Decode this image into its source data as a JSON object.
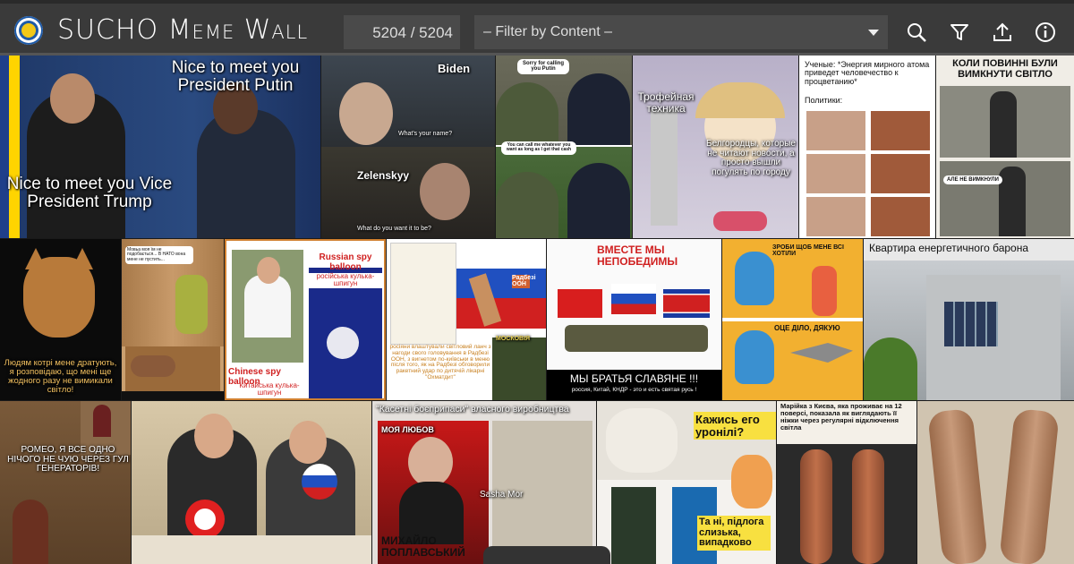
{
  "app": {
    "title_s": "SUCHO",
    "title_rest": "Meme Wall",
    "counter": "5204 / 5204",
    "filter_placeholder": "– Filter by Content –"
  },
  "toolbar_icons": [
    "search-icon",
    "filter-icon",
    "upload-icon",
    "info-icon"
  ],
  "memes": {
    "m1_top": "Nice to meet you President Putin",
    "m1_bottom": "Nice to meet you Vice President Trump",
    "m2_a": "Biden",
    "m2_b": "Zelenskyy",
    "m2_c": "What's your name?",
    "m2_d": "What do you want it to be?",
    "m3_a": "Sorry for calling you Putin",
    "m3_b": "You can call me whatever you want as long as I get that cash",
    "m4_a": "Трофейная техника",
    "m4_b": "Белгородцы, которые не читают новости, а просто вышли погулять по городу",
    "m5_a": "Ученые: *Энергия мирного атома приведет человечество к процветанию*",
    "m5_b": "Политики:",
    "m6_a": "КОЛИ ПОВИННІ БУЛИ ВИМКНУТИ СВІТЛО",
    "m6_b": "АЛЕ НЕ ВИМКНУЛИ",
    "m7_a": "Людям котрі мене дратують, я розповідаю, що мені ще жодного разу не вимикали світло!",
    "m8_a": "Мовьа моя їм не подобається... В НАТО вона мене не пустить...",
    "m9_a": "Russian spy balloon",
    "m9_b": "російська кулька-шпигун",
    "m9_c": "Chinese spy balloon",
    "m9_d": "Китайська кулька-шпигун",
    "m10_a": "Радбезі ООН",
    "m10_b": "росіяни влаштували світловий ланч з нагоди свого головування в Радбезі ООН, з вигнетом по-київськи в меню після того, як на Радбезі обговорили ракетний удар по дитячій лікарні \"Охматдит\"",
    "m10_c": "МОСКОВІЯ",
    "m11_a": "ВМЕСТЕ МЫ НЕПОБЕДИМЫ",
    "m11_b": "МЫ БРАТЬЯ СЛАВЯНЕ !!!",
    "m11_c": "россия, Китай, КНДР - это и есть святая русь !",
    "m12_a": "ЗРОБИ ЩОБ МЕНЕ ВСІ ХОТІЛИ",
    "m12_b": "ОЦЕ ДІЛО, ДЯКУЮ",
    "m13_a": "Квартира енергетичного барона",
    "m14_a": "РОМЕО, Я ВСЕ ОДНО НІЧОГО НЕ ЧУЮ ЧЕРЕЗ ГУЛ ГЕНЕРАТОРІВ!",
    "m16_a": "\"Касетні боєприпаси\" власного виробництва",
    "m16_b": "МОЯ ЛЮБОВ",
    "m16_c": "Sasha Mor",
    "m16_d": "МИХАЙЛО ПОПЛАВСЬКИЙ",
    "m17_a": "Кажись его уронілі?",
    "m17_b": "Та ні, підлога слизька, випадково",
    "m18_a": "Марійка з Києва, яка проживає на 12 поверсі, показала як виглядають її ніжки через регулярні відключення світла"
  },
  "colors": {
    "topbar": "#3a3a3a",
    "input_bg": "#4a4a4a",
    "text": "#ffffff",
    "accent_yellow": "#f2c818",
    "accent_blue": "#1e5aa8"
  }
}
